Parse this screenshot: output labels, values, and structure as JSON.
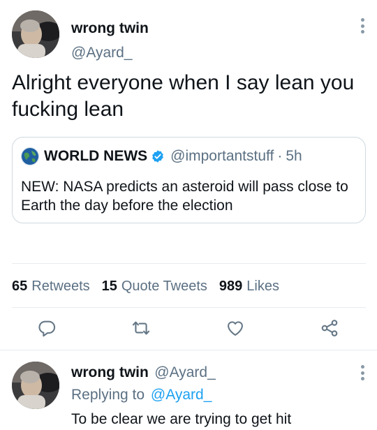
{
  "tweet": {
    "author_name": "wrong twin",
    "author_handle": "@Ayard_",
    "text": "Alright everyone when I say lean you fucking lean",
    "more_icon": "more-vertical-icon"
  },
  "quote": {
    "author_name": "WORLD NEWS",
    "verified_icon": "verified-badge-icon",
    "author_handle": "@importantstuff",
    "separator": "·",
    "time": "5h",
    "text": "NEW: NASA predicts an asteroid will pass close to Earth the day before the election"
  },
  "stats": {
    "retweets_count": "65",
    "retweets_label": "Retweets",
    "quotes_count": "15",
    "quotes_label": "Quote Tweets",
    "likes_count": "989",
    "likes_label": "Likes"
  },
  "actions": [
    "reply-icon",
    "retweet-icon",
    "like-icon",
    "share-icon"
  ],
  "reply": {
    "author_name": "wrong twin",
    "author_handle": "@Ayard_",
    "replying_prefix": "Replying to",
    "replying_handle": "@Ayard_",
    "text": "To be clear we are trying to get hit"
  },
  "colors": {
    "accent": "#1da1f2",
    "secondary_text": "#5b7083",
    "icon": "#657786",
    "border": "#cfd9de"
  }
}
